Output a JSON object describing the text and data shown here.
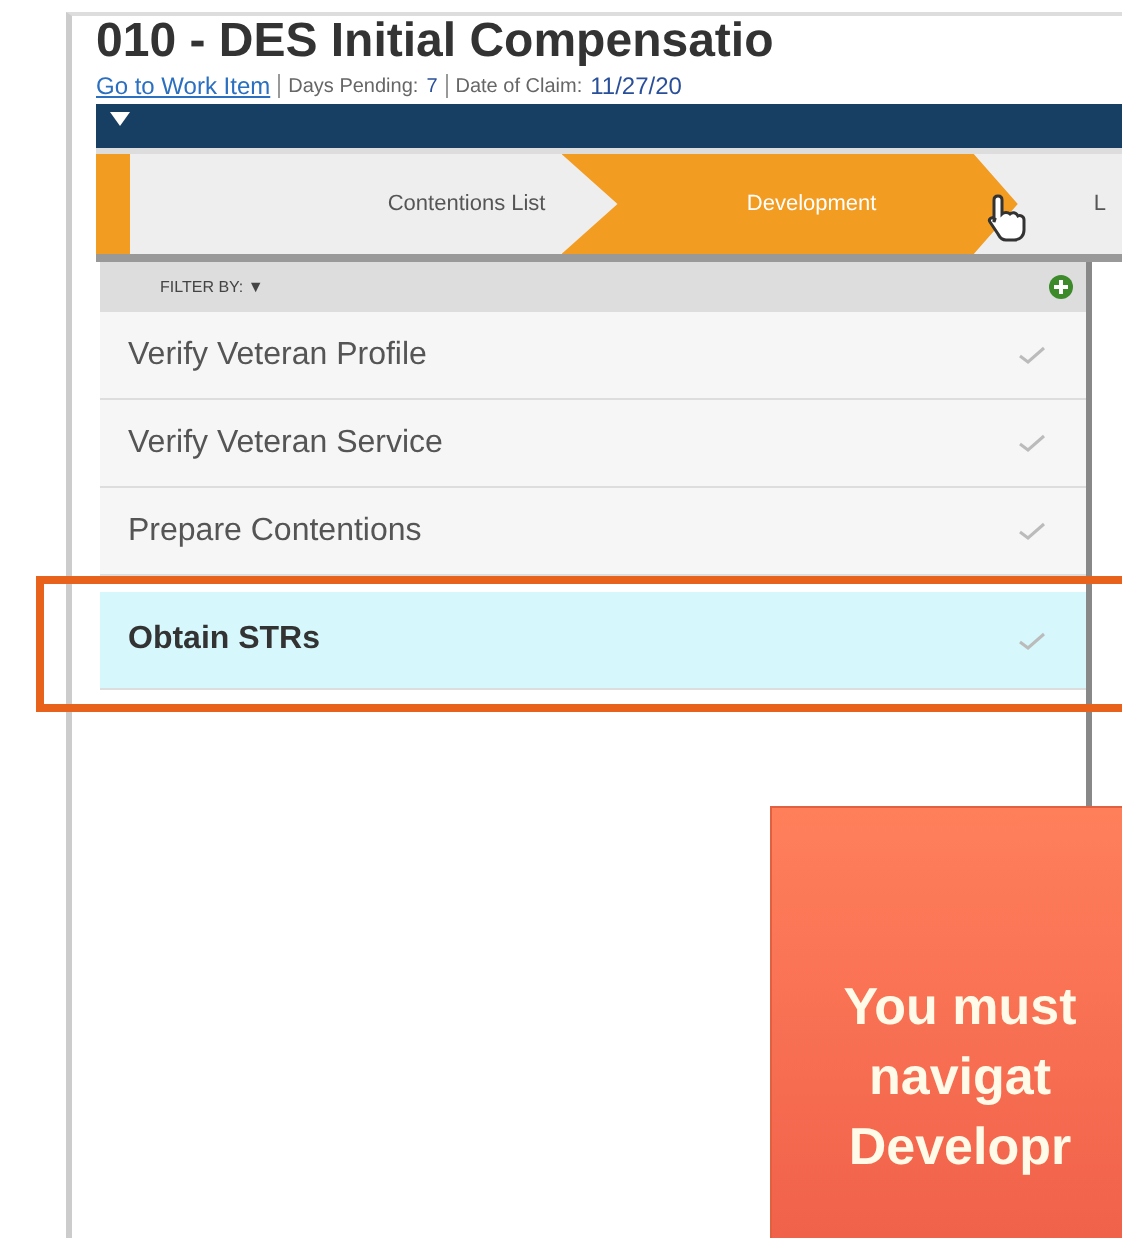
{
  "header": {
    "title": "010 - DES Initial Compensatio",
    "link": "Go to Work Item",
    "days_label": "Days Pending:",
    "days_value": "7",
    "date_label": "Date of Claim:",
    "date_value": "11/27/20"
  },
  "steps": [
    {
      "label": "Contentions List",
      "selected": false
    },
    {
      "label": "Development",
      "selected": true
    },
    {
      "label": "L",
      "selected": false
    }
  ],
  "filter": {
    "label": "FILTER BY: ▼"
  },
  "tasks": [
    {
      "label": "Verify Veteran Profile",
      "selected": false
    },
    {
      "label": "Verify Veteran Service",
      "selected": false
    },
    {
      "label": "Prepare Contentions",
      "selected": false
    },
    {
      "label": "Obtain STRs",
      "selected": true
    }
  ],
  "callout": {
    "lines": [
      "You must",
      "navigat",
      "Developr"
    ]
  }
}
